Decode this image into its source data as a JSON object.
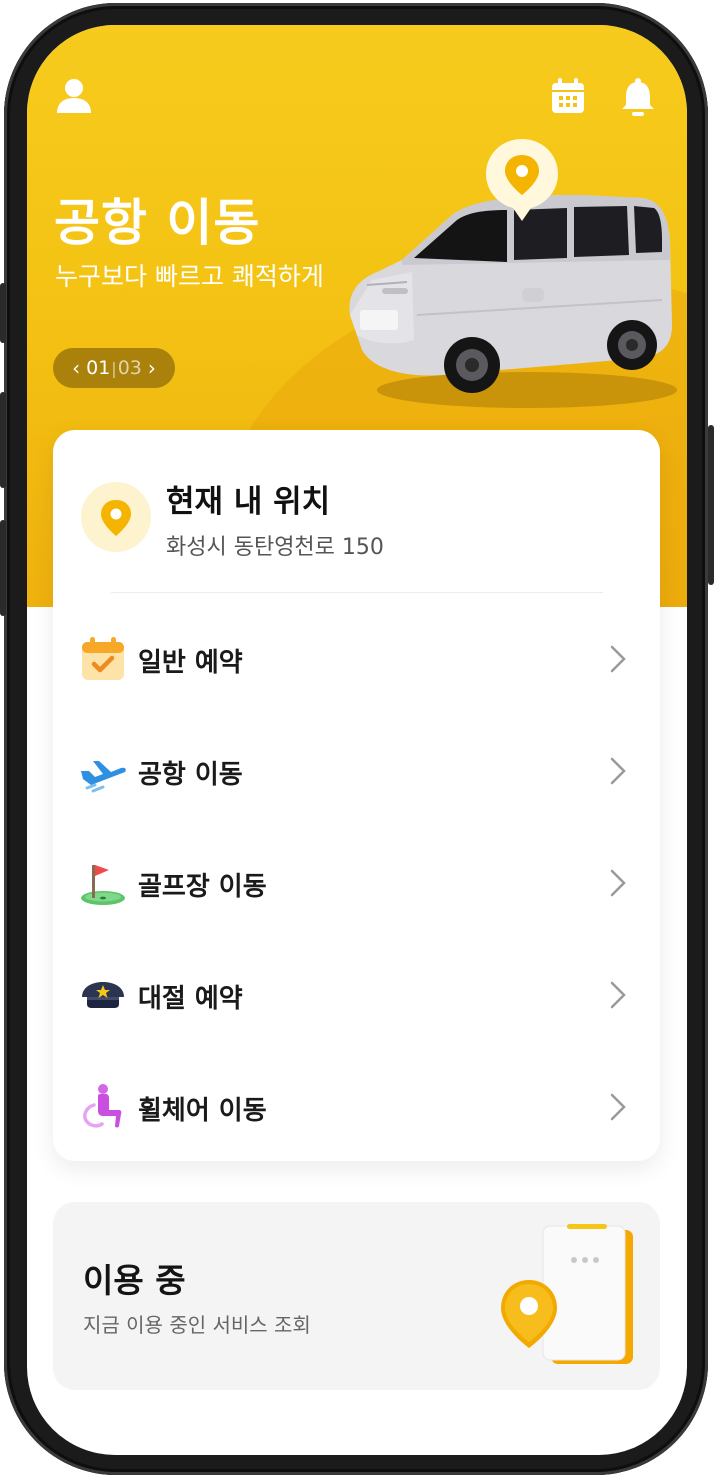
{
  "header": {
    "profile_icon": "person-icon",
    "calendar_icon": "calendar-icon",
    "notification_icon": "bell-icon"
  },
  "hero": {
    "title": "공항 이동",
    "subtitle": "누구보다 빠르고 쾌적하게",
    "pager": {
      "current": "01",
      "separator": "|",
      "total": "03"
    }
  },
  "location": {
    "title": "현재 내 위치",
    "address": "화성시 동탄영천로 150",
    "icon": "location-pin-icon"
  },
  "menu": [
    {
      "label": "일반 예약",
      "icon": "calendar-check-icon"
    },
    {
      "label": "공항 이동",
      "icon": "airplane-icon"
    },
    {
      "label": "골프장 이동",
      "icon": "golf-flag-icon"
    },
    {
      "label": "대절 예약",
      "icon": "chauffeur-cap-icon"
    },
    {
      "label": "휠체어 이동",
      "icon": "wheelchair-icon"
    }
  ],
  "usage": {
    "title": "이용 중",
    "description": "지금 이용 중인 서비스 조회"
  },
  "colors": {
    "brand_yellow": "#f4c314",
    "brand_orange": "#efb10e",
    "text_dark": "#111111"
  }
}
